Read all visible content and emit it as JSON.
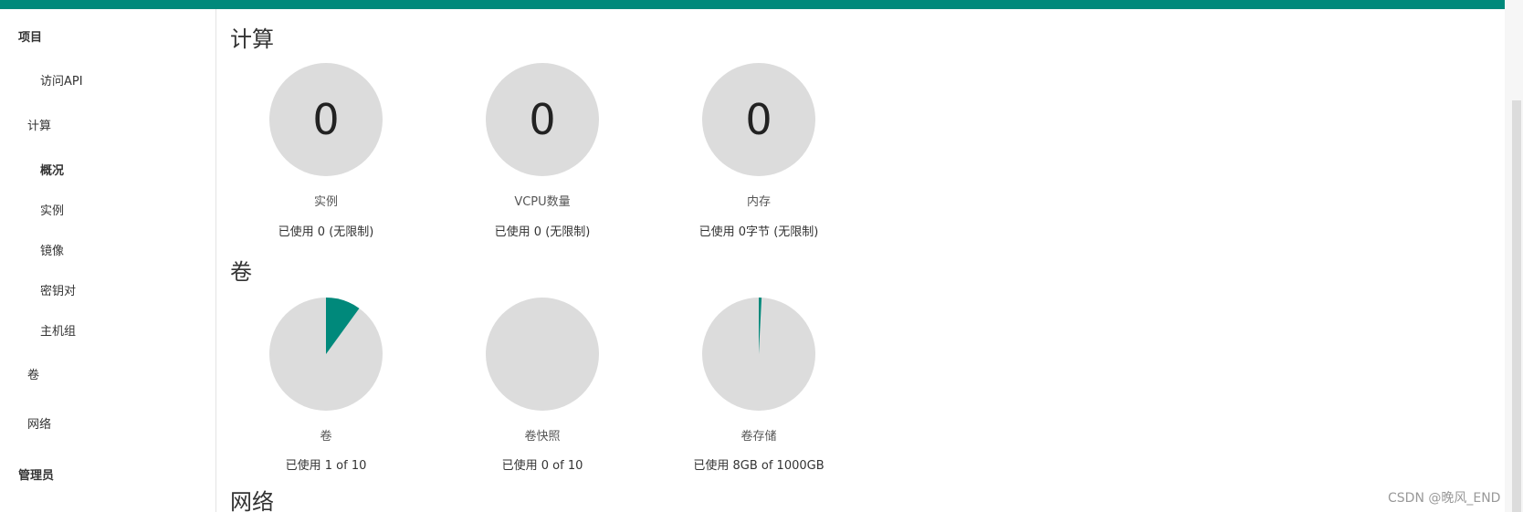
{
  "sidebar": {
    "project": "项目",
    "api_access": "访问API",
    "compute": "计算",
    "overview": "概况",
    "instances": "实例",
    "images": "镜像",
    "keypairs": "密钥对",
    "server_groups": "主机组",
    "volumes": "卷",
    "network": "网络",
    "admin": "管理员"
  },
  "main": {
    "compute_title": "计算",
    "volume_title": "卷",
    "network_title": "网络",
    "compute": [
      {
        "value": "0",
        "label": "实例",
        "usage": "已使用 0 (无限制)"
      },
      {
        "value": "0",
        "label": "VCPU数量",
        "usage": "已使用 0 (无限制)"
      },
      {
        "value": "0",
        "label": "内存",
        "usage": "已使用 0字节 (无限制)"
      }
    ],
    "volume": [
      {
        "label": "卷",
        "usage": "已使用 1 of 10",
        "used_fraction": 0.1
      },
      {
        "label": "卷快照",
        "usage": "已使用 0 of 10",
        "used_fraction": 0
      },
      {
        "label": "卷存储",
        "usage": "已使用 8GB of 1000GB",
        "used_fraction": 0.008
      }
    ]
  },
  "colors": {
    "accent": "#00897b",
    "pie_bg": "#dcdcdc"
  },
  "watermark": "CSDN @晚风_END"
}
